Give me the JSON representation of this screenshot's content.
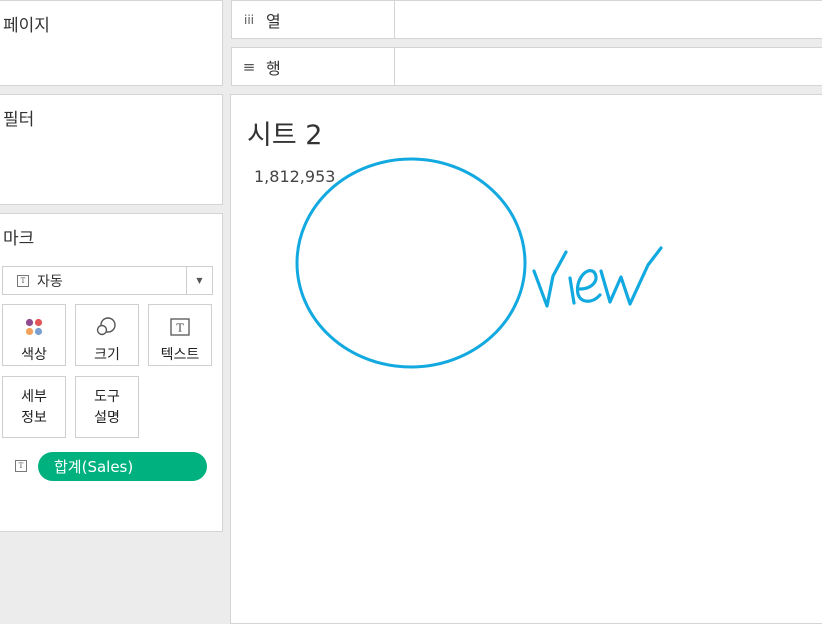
{
  "panels": {
    "pages_title": "페이지",
    "filters_title": "필터",
    "marks_title": "마크"
  },
  "shelves": {
    "columns_label": "열",
    "columns_icon": "iii",
    "rows_label": "행",
    "rows_icon": "≡"
  },
  "marks": {
    "type_label": "자동",
    "type_icon": "T",
    "buttons": {
      "color": "색상",
      "size": "크기",
      "text": "텍스트",
      "detail": [
        "세부",
        "정보"
      ],
      "tooltip": [
        "도구",
        "설명"
      ]
    },
    "pill_label": "합계(Sales)",
    "pill_icon": "T"
  },
  "sheet": {
    "title": "시트 2",
    "value": "1,812,953"
  },
  "colors": {
    "pill": "#00b180",
    "annotation": "#12a9e0"
  }
}
